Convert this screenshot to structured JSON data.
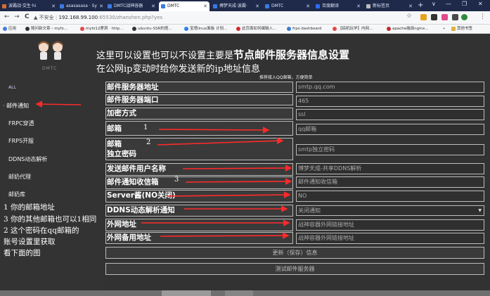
{
  "browser": {
    "tabs": [
      {
        "label": "波霸战·交生·hi",
        "fav": "#d86b2a"
      },
      {
        "label": "asasasasa · Sy",
        "fav": "#3b7be0"
      },
      {
        "label": "DMTC战神容器",
        "fav": "#3b7be0"
      },
      {
        "label": "DMTC",
        "fav": "#3b7be0",
        "active": true
      },
      {
        "label": "搏梦天成·波霸·",
        "fav": "#3b7be0"
      },
      {
        "label": "DMTC",
        "fav": "#3b7be0"
      },
      {
        "label": "百度翻译",
        "fav": "#2d6cf2"
      },
      {
        "label": "新标签页",
        "fav": "#bbbbbb"
      }
    ],
    "window_controls": [
      "∨",
      "—",
      "❐",
      "✕"
    ],
    "nav": {
      "back": "←",
      "forward": "→",
      "reload": "C"
    },
    "url": {
      "warning": "▲ 不安全",
      "host": "192.168.99.100",
      "path": ":65530/zhanshen.php?yes"
    },
    "bookmarks": [
      {
        "label": "应用",
        "color": "#4a7be0"
      },
      {
        "label": "随问新文章 › myfz...",
        "color": "#333333"
      },
      {
        "label": "myfz12摩洞 · http...",
        "color": "#e24b4b"
      },
      {
        "label": "ubuntu-SSR的搭...",
        "color": "#333333"
      },
      {
        "label": "宝塔linux面板 计划...",
        "color": "#2f80ed"
      },
      {
        "label": "此页面如何编辑入...",
        "color": "#d22d2d"
      },
      {
        "label": "frps dashboard",
        "color": "#3c7bd6"
      },
      {
        "label": "【搞机玩学】内网...",
        "color": "#e24b4b"
      },
      {
        "label": "apache端液nginx...",
        "color": "#c22a2a"
      },
      {
        "label": "其他书签",
        "color": "#e0b23b"
      }
    ],
    "bookmarks_more": "»"
  },
  "sidebar": {
    "logo_text": "DMTC",
    "items": [
      {
        "label": "ALL",
        "small": true
      },
      {
        "label": "· 邮件通知",
        "active": true
      },
      {
        "label": "FRPC穿透"
      },
      {
        "label": "FRPS开服"
      },
      {
        "label": "DDNS动态解析"
      },
      {
        "label": "邮奶代理"
      },
      {
        "label": "邮奶库"
      }
    ]
  },
  "header": {
    "line1_prefix": "这里可以设置也可以不设置主要是",
    "line1_bold": "节点邮件服务器信息设置",
    "line2": "在公网ip变动时给你发送新的ip地址信息",
    "note": "推荐接入QQ邮箱，方便简单"
  },
  "form": {
    "rows": [
      {
        "label": "邮件服务器地址",
        "value": "smtp.qq.com"
      },
      {
        "label": "邮件服务器端口",
        "value": "465"
      },
      {
        "label": "加密方式",
        "value": "ssl"
      },
      {
        "label": "邮箱",
        "value": "qq邮箱"
      },
      {
        "label": "邮箱\n独立密码",
        "value": "smtp独立密码"
      },
      {
        "label": "发送邮件用户名称",
        "value": "博梦天成-共享DDNS解析"
      },
      {
        "label": "邮件通知收信箱",
        "value": "邮件通知收信箱"
      },
      {
        "label": "Server酱(NO关闭)",
        "value": "NO"
      },
      {
        "label": "DDNS动态解析通知",
        "value": "关闭通知",
        "select": true
      },
      {
        "label": "外网地址",
        "value": "战神容器外网链接地址"
      },
      {
        "label": "外网备用地址",
        "value": "战神容器外网链接地址"
      }
    ],
    "save_button": "更新（保存）信息",
    "test_button": "测试邮件服务器"
  },
  "annotations": {
    "n1": "1",
    "n2": "2",
    "n3": "3",
    "notes": [
      "1 你的邮箱地址",
      "3 你的其他邮箱也可以1相同",
      "2 这个密码在qq邮箱的",
      "账号设置里获取",
      "看下面的图"
    ]
  },
  "colors": {
    "arrow": "#ff2a2a",
    "sidebar_bg": "#333333",
    "main_bg": "#323232"
  }
}
